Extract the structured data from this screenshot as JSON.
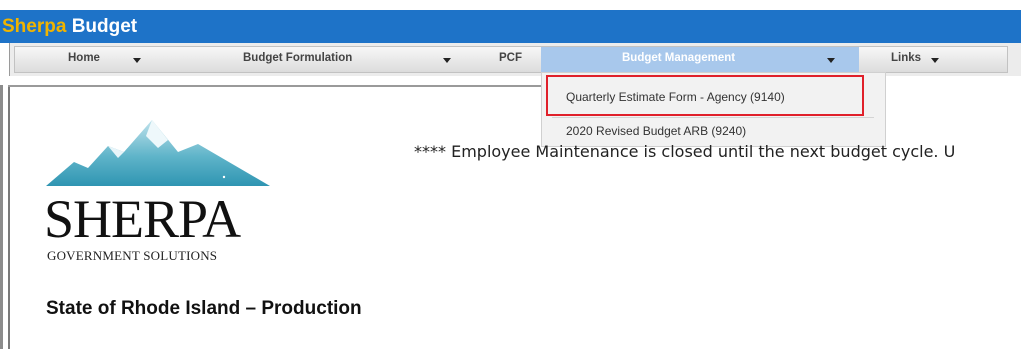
{
  "app": {
    "title_part_1": "Sherpa",
    "title_part_2": " Budget"
  },
  "nav": {
    "items": [
      {
        "label": "Home"
      },
      {
        "label": "Budget Formulation"
      },
      {
        "label": "PCF"
      },
      {
        "label": "Budget Management",
        "active": true
      },
      {
        "label": "Links"
      }
    ]
  },
  "dropdown": {
    "items": [
      {
        "label": "Quarterly Estimate Form - Agency (9140)",
        "highlighted": true
      },
      {
        "label": "2020 Revised Budget ARB (9240)"
      }
    ]
  },
  "logo": {
    "word": "SHERPA",
    "sub": "GOVERNMENT SOLUTIONS"
  },
  "announcement": "**** Employee Maintenance is closed until the next budget cycle. U",
  "org_name": "State of Rhode Island – Production",
  "colors": {
    "titlebar": "#1e73c8",
    "title_accent": "#f0b400",
    "nav_active": "#a8c8ec",
    "highlight": "#e0202a",
    "logo_teal": "#3a9eb8"
  }
}
